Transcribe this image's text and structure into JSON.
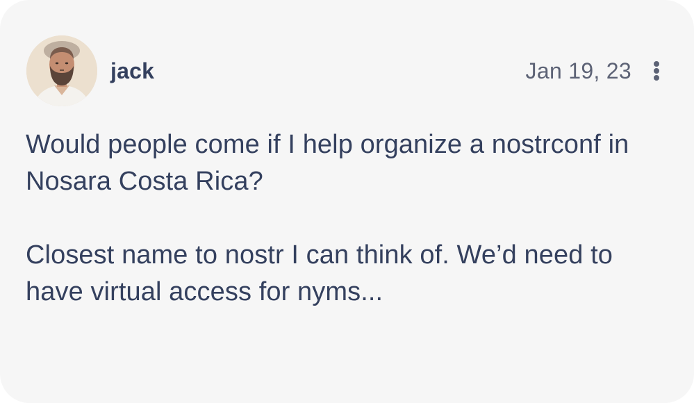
{
  "post": {
    "author": {
      "username": "jack",
      "avatar_icon": "user-avatar-photo"
    },
    "timestamp": "Jan 19, 23",
    "menu_icon": "more-vertical-icon",
    "paragraphs": [
      "Would people come if I help organize a nostrconf in Nosara Costa Rica?",
      "Closest name to nostr I can think of. We’d need to have virtual access for nyms..."
    ]
  },
  "colors": {
    "card_background": "#f6f6f6",
    "text_primary": "#34405e",
    "text_secondary": "#5c6275"
  }
}
